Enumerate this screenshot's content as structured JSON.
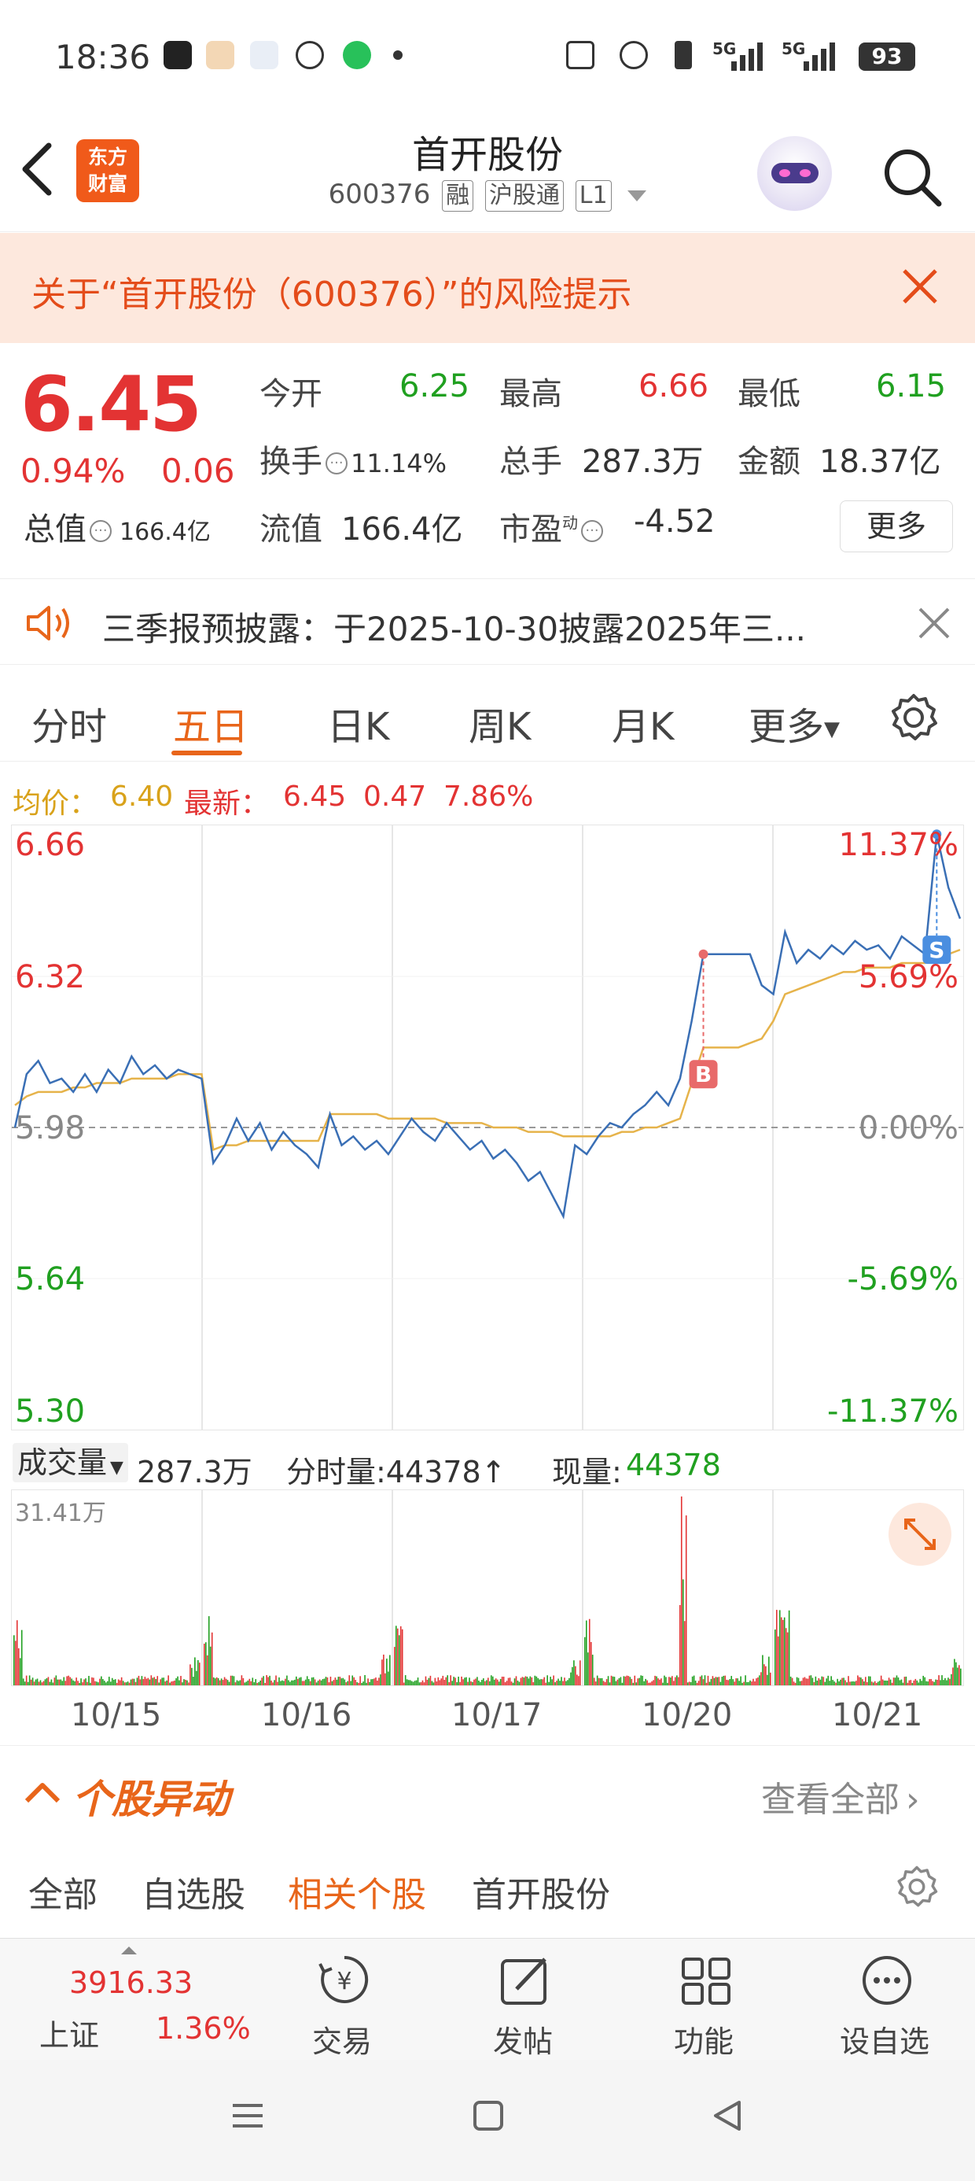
{
  "status": {
    "time": "18:36",
    "battery": "93",
    "net1": "5G",
    "net2": "5G"
  },
  "header": {
    "brand": "东方\n财富",
    "name": "首开股份",
    "code": "600376",
    "tags": [
      "融",
      "沪股通",
      "L1"
    ]
  },
  "risk": {
    "text": "关于“首开股份（600376）”的风险提示"
  },
  "quote": {
    "price": "6.45",
    "pct": "0.94%",
    "chg": "0.06",
    "total_label": "总值",
    "total_value": "166.4亿",
    "open_label": "今开",
    "open": "6.25",
    "high_label": "最高",
    "high": "6.66",
    "low_label": "最低",
    "low": "6.15",
    "turn_label": "换手",
    "turn": "11.14%",
    "vol_label": "总手",
    "vol": "287.3万",
    "amt_label": "金额",
    "amt": "18.37亿",
    "float_label": "流值",
    "float": "166.4亿",
    "pe_label": "市盈",
    "pe_sup": "动",
    "pe": "-4.52",
    "more": "更多"
  },
  "notice": {
    "text": "三季报预披露：于2025-10-30披露2025年三..."
  },
  "tabs": [
    "分时",
    "五日",
    "日K",
    "周K",
    "月K",
    "更多"
  ],
  "avgline": {
    "avg_label": "均价：",
    "avg": "6.40",
    "last_label": "最新：",
    "last": "6.45",
    "chg": "0.47",
    "pct": "7.86%"
  },
  "chart_data": {
    "type": "line",
    "title": "",
    "x": [
      "10/15",
      "10/16",
      "10/17",
      "10/20",
      "10/21"
    ],
    "y_ticks": [
      "6.66",
      "6.32",
      "5.98",
      "5.64",
      "5.30"
    ],
    "pct_ticks": [
      "11.37%",
      "5.69%",
      "0.00%",
      "-5.69%",
      "-11.37%"
    ],
    "ylim": [
      5.3,
      6.66
    ],
    "prev_close": 5.98,
    "series": [
      {
        "values": [
          5.98,
          6.1,
          6.13,
          6.08,
          6.09,
          6.06,
          6.1,
          6.06,
          6.11,
          6.08,
          6.14,
          6.1,
          6.12,
          6.09,
          6.11,
          6.1,
          6.09,
          5.9,
          5.94,
          6.0,
          5.95,
          5.99,
          5.93,
          5.97,
          5.94,
          5.92,
          5.89,
          6.01,
          5.94,
          5.96,
          5.93,
          5.95,
          5.92,
          5.96,
          6.0,
          5.97,
          5.95,
          5.99,
          5.96,
          5.93,
          5.95,
          5.91,
          5.93,
          5.9,
          5.86,
          5.88,
          5.83,
          5.78,
          5.94,
          5.92,
          5.96,
          5.99,
          5.98,
          6.01,
          6.03,
          6.06,
          6.03,
          6.09,
          6.22,
          6.37,
          6.37,
          6.37,
          6.37,
          6.37,
          6.3,
          6.28,
          6.42,
          6.35,
          6.38,
          6.36,
          6.39,
          6.37,
          6.4,
          6.38,
          6.39,
          6.36,
          6.41,
          6.39,
          6.37,
          6.64,
          6.52,
          6.45
        ]
      },
      {
        "values": [
          6.03,
          6.05,
          6.06,
          6.06,
          6.06,
          6.07,
          6.07,
          6.08,
          6.08,
          6.08,
          6.09,
          6.09,
          6.09,
          6.09,
          6.1,
          6.1,
          6.1,
          5.93,
          5.94,
          5.94,
          5.95,
          5.95,
          5.95,
          5.95,
          5.95,
          5.95,
          5.95,
          6.01,
          6.01,
          6.01,
          6.01,
          6.01,
          6.0,
          6.0,
          6.0,
          6.0,
          6.0,
          5.99,
          5.99,
          5.99,
          5.99,
          5.98,
          5.98,
          5.98,
          5.97,
          5.97,
          5.97,
          5.96,
          5.96,
          5.96,
          5.96,
          5.96,
          5.97,
          5.97,
          5.98,
          5.98,
          5.99,
          6.0,
          6.08,
          6.16,
          6.16,
          6.16,
          6.16,
          6.17,
          6.18,
          6.22,
          6.28,
          6.29,
          6.3,
          6.31,
          6.32,
          6.33,
          6.33,
          6.34,
          6.34,
          6.34,
          6.35,
          6.35,
          6.35,
          6.36,
          6.37,
          6.38
        ]
      }
    ],
    "markers": [
      {
        "label": "B",
        "value": 6.37
      },
      {
        "label": "S",
        "value": 6.64
      }
    ]
  },
  "volume": {
    "label": "成交量",
    "total": "287.3万",
    "tick_label": "分时量:44378↑",
    "now_label": "现量:",
    "now": "44378",
    "max": "31.41万"
  },
  "movers": {
    "title": "个股异动",
    "all": "查看全部"
  },
  "subtabs": [
    "全部",
    "自选股",
    "相关个股",
    "首开股份"
  ],
  "nav": {
    "index_value": "3916.33",
    "index_name": "上证",
    "index_pct": "1.36%",
    "items": [
      "交易",
      "发帖",
      "功能",
      "设自选"
    ]
  }
}
